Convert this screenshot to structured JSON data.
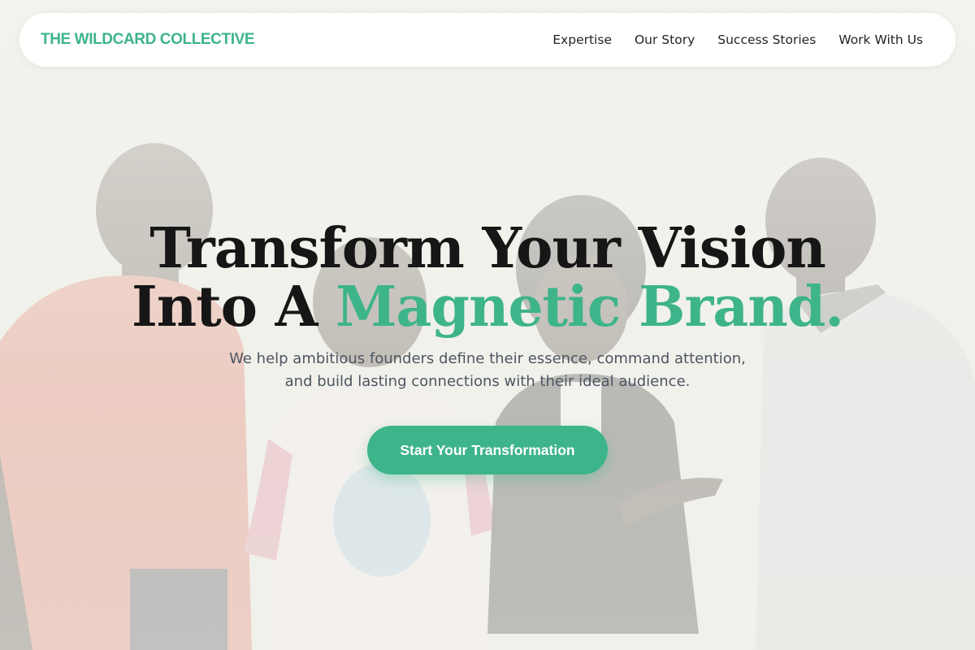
{
  "brand": {
    "name": "THE WILDCARD COLLECTIVE",
    "accent_color": "#3eb48a"
  },
  "nav": {
    "items": [
      "Expertise",
      "Our Story",
      "Success Stories",
      "Work With Us"
    ]
  },
  "hero": {
    "headline_line1": "Transform Your Vision",
    "headline_line2_prefix": "Into A ",
    "headline_line2_accent": "Magnetic Brand.",
    "subtext_line1": "We help ambitious founders define their essence, command attention,",
    "subtext_line2": "and build lasting connections with their ideal audience.",
    "cta_label": "Start Your Transformation"
  }
}
